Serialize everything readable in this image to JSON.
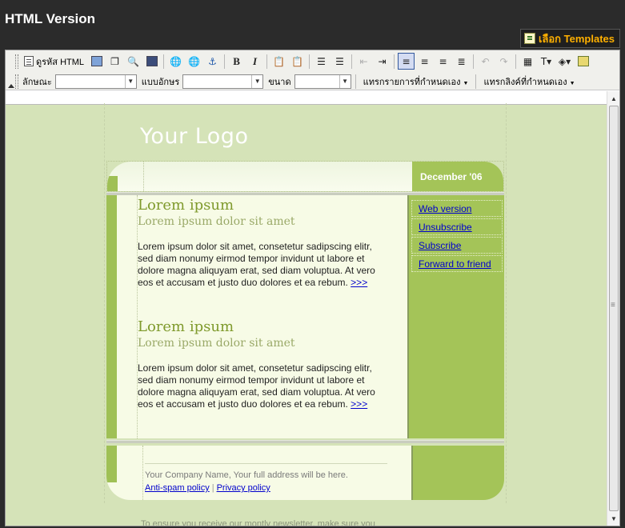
{
  "page": {
    "title": "HTML Version",
    "templates_button": "เลือก Templates"
  },
  "toolbar": {
    "html_code_label": "ดูรหัส HTML",
    "row2": {
      "style_label": "ลักษณะ",
      "font_label": "แบบอักษร",
      "size_label": "ขนาด",
      "insert_item_label": "แทรกรายการที่กำหนดเอง",
      "insert_link_label": "แทรกลิงค์ที่กำหนดเอง"
    }
  },
  "newsletter": {
    "logo": "Your Logo",
    "date": "December '06",
    "articles": [
      {
        "title": "Lorem ipsum",
        "subtitle": "Lorem ipsum dolor sit amet",
        "body": "Lorem ipsum dolor sit amet, consetetur sadipscing elitr, sed diam nonumy eirmod tempor invidunt ut labore et dolore magna aliquyam erat, sed diam voluptua. At vero eos et accusam et justo duo dolores et ea rebum.",
        "more": ">>>"
      },
      {
        "title": "Lorem ipsum",
        "subtitle": "Lorem ipsum dolor sit amet",
        "body": "Lorem ipsum dolor sit amet, consetetur sadipscing elitr, sed diam nonumy eirmod tempor invidunt ut labore et dolore magna aliquyam erat, sed diam voluptua. At vero eos et accusam et justo duo dolores et ea rebum.",
        "more": ">>>"
      }
    ],
    "side_links": [
      "Web version",
      "Unsubscribe",
      "Subscribe",
      "Forward to friend"
    ],
    "footer": {
      "address": "Your Company Name, Your full address will be here.",
      "antispam": "Anti-spam policy",
      "separator": "|",
      "privacy": "Privacy policy"
    },
    "bottom_text": "To ensure you receive our montly newsletter, make sure you"
  },
  "colors": {
    "background": "#2b2b2b",
    "accent_orange": "#ffb000",
    "newsletter_bg": "#d5e3b8",
    "newsletter_green": "#a4c458",
    "title_green": "#7f9a2c"
  }
}
